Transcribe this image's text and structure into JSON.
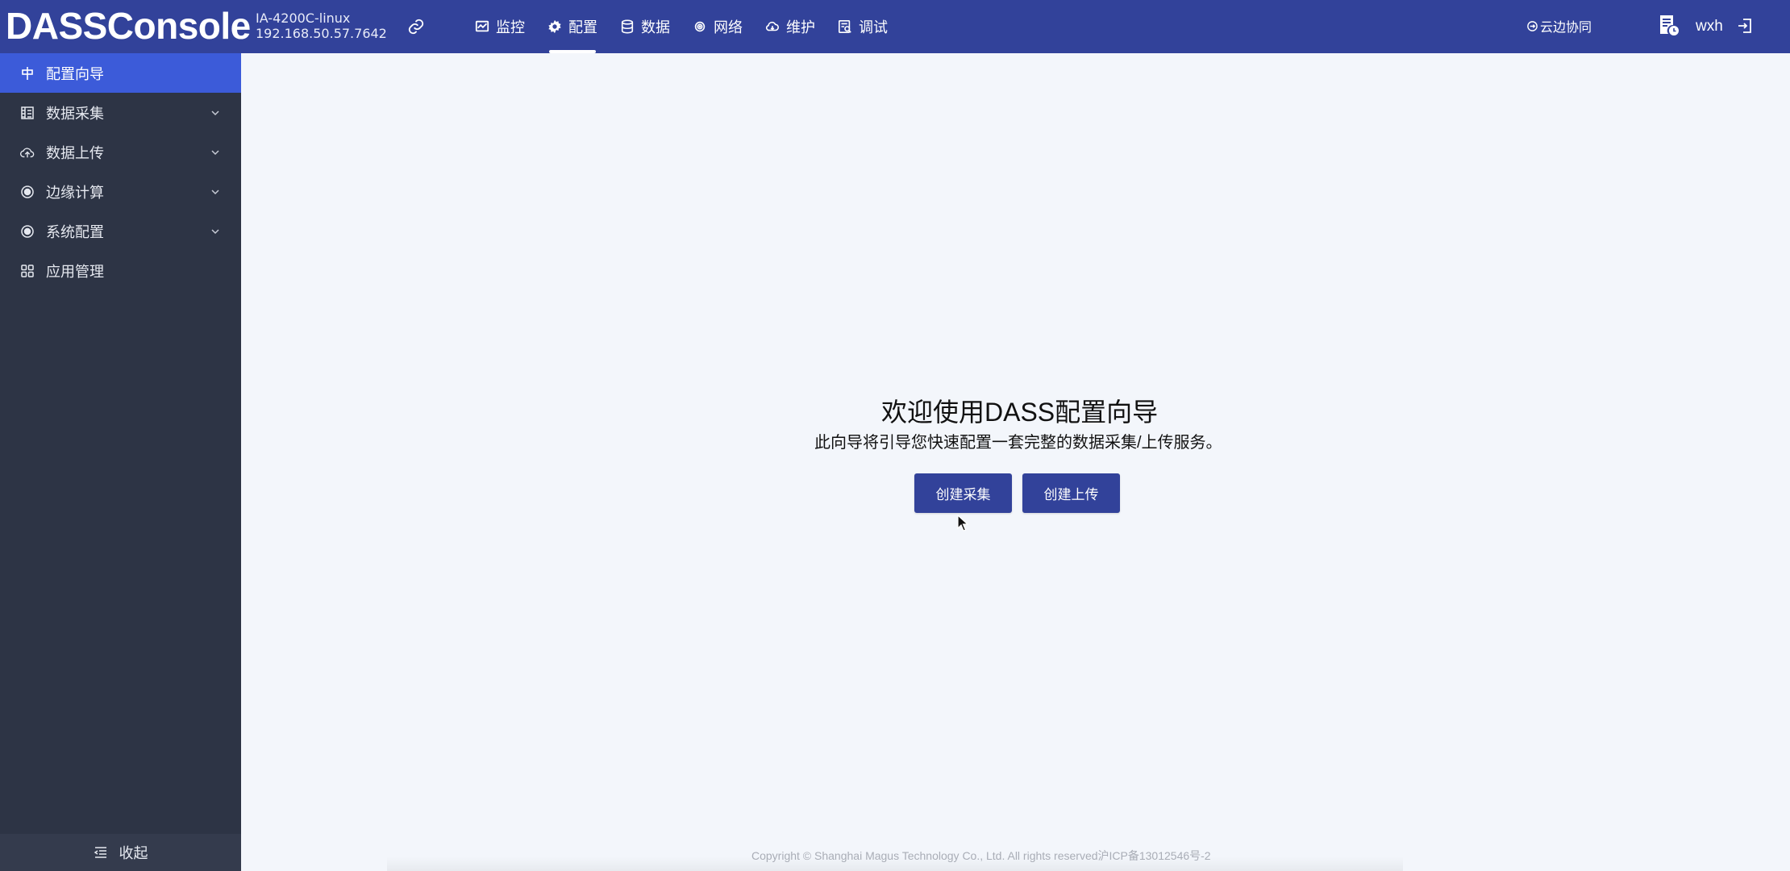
{
  "header": {
    "brand": "DASSConsole",
    "device_model": "IA-4200C-linux",
    "device_address": "192.168.50.57.7642",
    "nav": [
      {
        "label": "监控",
        "icon": "monitor-icon"
      },
      {
        "label": "配置",
        "icon": "gear-icon",
        "active": true
      },
      {
        "label": "数据",
        "icon": "database-icon"
      },
      {
        "label": "网络",
        "icon": "network-icon"
      },
      {
        "label": "维护",
        "icon": "cloud-icon"
      },
      {
        "label": "调试",
        "icon": "debug-icon"
      }
    ],
    "cloud_label": "云边协同",
    "user": "wxh"
  },
  "sidebar": {
    "items": [
      {
        "label": "配置向导",
        "icon": "wizard-icon",
        "active": true
      },
      {
        "label": "数据采集",
        "icon": "collect-icon",
        "expandable": true
      },
      {
        "label": "数据上传",
        "icon": "upload-icon",
        "expandable": true
      },
      {
        "label": "边缘计算",
        "icon": "chip-icon",
        "expandable": true
      },
      {
        "label": "系统配置",
        "icon": "settings-icon",
        "expandable": true
      },
      {
        "label": "应用管理",
        "icon": "apps-icon"
      }
    ],
    "collapse_label": "收起"
  },
  "main": {
    "title": "欢迎使用DASS配置向导",
    "subtitle": "此向导将引导您快速配置一套完整的数据采集/上传服务。",
    "buttons": {
      "create_collect": "创建采集",
      "create_upload": "创建上传"
    }
  },
  "footer": {
    "copyright": "Copyright © Shanghai Magus Technology Co., Ltd. All rights reserved沪ICP备13012546号-2"
  },
  "colors": {
    "topbar": "#32429a",
    "sidebar": "#2d3445",
    "sidebar_active": "#3c5bd9",
    "content_bg": "#f3f6fb",
    "button": "#32429a"
  }
}
